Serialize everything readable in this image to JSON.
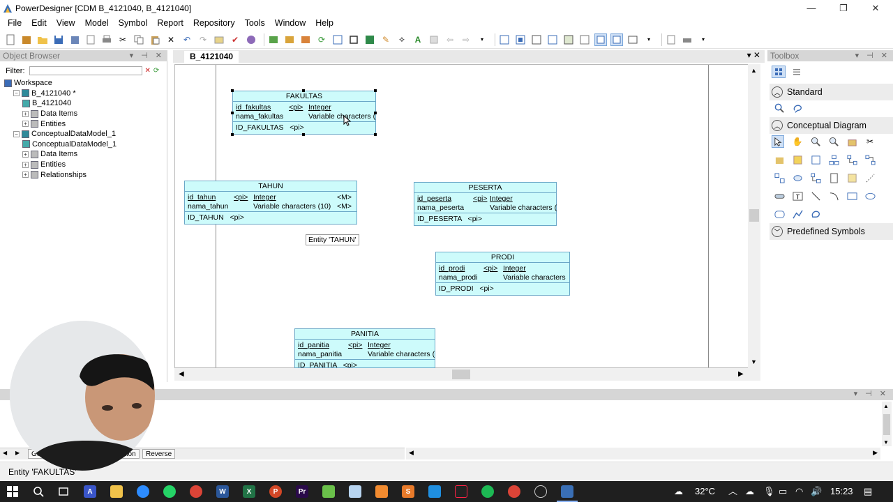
{
  "window": {
    "title": "PowerDesigner [CDM B_4121040, B_4121040]",
    "minimize": "—",
    "maximize": "❐",
    "close": "✕"
  },
  "menu": [
    "File",
    "Edit",
    "View",
    "Model",
    "Symbol",
    "Report",
    "Repository",
    "Tools",
    "Window",
    "Help"
  ],
  "object_browser": {
    "title": "Object Browser",
    "filter_label": "Filter:",
    "filter_value": "",
    "tree": [
      {
        "label": "Workspace",
        "level": 0,
        "expander": "",
        "icon": "workspace-icon"
      },
      {
        "label": "B_4121040 *",
        "level": 1,
        "expander": "−",
        "icon": "model-icon"
      },
      {
        "label": "B_4121040",
        "level": 2,
        "expander": "",
        "icon": "diagram-icon"
      },
      {
        "label": "Data Items",
        "level": 2,
        "expander": "+",
        "icon": "folder-icon"
      },
      {
        "label": "Entities",
        "level": 2,
        "expander": "+",
        "icon": "folder-icon"
      },
      {
        "label": "ConceptualDataModel_1",
        "level": 1,
        "expander": "−",
        "icon": "model-icon"
      },
      {
        "label": "ConceptualDataModel_1",
        "level": 2,
        "expander": "",
        "icon": "diagram-icon"
      },
      {
        "label": "Data Items",
        "level": 2,
        "expander": "+",
        "icon": "folder-icon"
      },
      {
        "label": "Entities",
        "level": 2,
        "expander": "+",
        "icon": "folder-icon"
      },
      {
        "label": "Relationships",
        "level": 2,
        "expander": "+",
        "icon": "folder-icon"
      }
    ]
  },
  "diagram": {
    "tab": "B_4121040",
    "tooltip": "Entity 'TAHUN'",
    "entities": {
      "fakultas": {
        "name": "FAKULTAS",
        "attrs": [
          {
            "name": "id_fakultas",
            "key": "<pi>",
            "type": "Integer",
            "m": ""
          },
          {
            "name": "nama_fakultas",
            "key": "",
            "type": "Variable characters (",
            "m": ""
          }
        ],
        "identifier": "ID_FAKULTAS   <pi>"
      },
      "tahun": {
        "name": "TAHUN",
        "attrs": [
          {
            "name": "id_tahun",
            "key": "<pi>",
            "type": "Integer",
            "m": "<M>"
          },
          {
            "name": "nama_tahun",
            "key": "",
            "type": "Variable characters (10)",
            "m": "<M>"
          }
        ],
        "identifier": "ID_TAHUN   <pi>"
      },
      "peserta": {
        "name": "PESERTA",
        "attrs": [
          {
            "name": "id_peserta",
            "key": "<pi>",
            "type": "Integer",
            "m": ""
          },
          {
            "name": "nama_peserta",
            "key": "",
            "type": "Variable characters (",
            "m": ""
          }
        ],
        "identifier": "ID_PESERTA   <pi>"
      },
      "prodi": {
        "name": "PRODI",
        "attrs": [
          {
            "name": "id_prodi",
            "key": "<pi>",
            "type": "Integer",
            "m": ""
          },
          {
            "name": "nama_prodi",
            "key": "",
            "type": "Variable characters",
            "m": ""
          }
        ],
        "identifier": "ID_PRODI   <pi>"
      },
      "panitia": {
        "name": "PANITIA",
        "attrs": [
          {
            "name": "id_panitia",
            "key": "<pi>",
            "type": "Integer",
            "m": ""
          },
          {
            "name": "nama_panitia",
            "key": "",
            "type": "Variable characters (",
            "m": ""
          }
        ],
        "identifier": "ID_PANITIA   <pi>"
      }
    }
  },
  "toolbox": {
    "title": "Toolbox",
    "sections": {
      "standard": "Standard",
      "conceptual": "Conceptual Diagram",
      "predefined": "Predefined Symbols"
    }
  },
  "output": {
    "tabs": [
      "Ge",
      "ation",
      "Reverse"
    ]
  },
  "status": "Entity 'FAKULTAS'",
  "taskbar": {
    "temperature": "32°C",
    "time": "15:23"
  },
  "colors": {
    "entity_fill": "#cdfbfb",
    "entity_border": "#6aa7c7",
    "taskbar": "#1f1f1f"
  }
}
